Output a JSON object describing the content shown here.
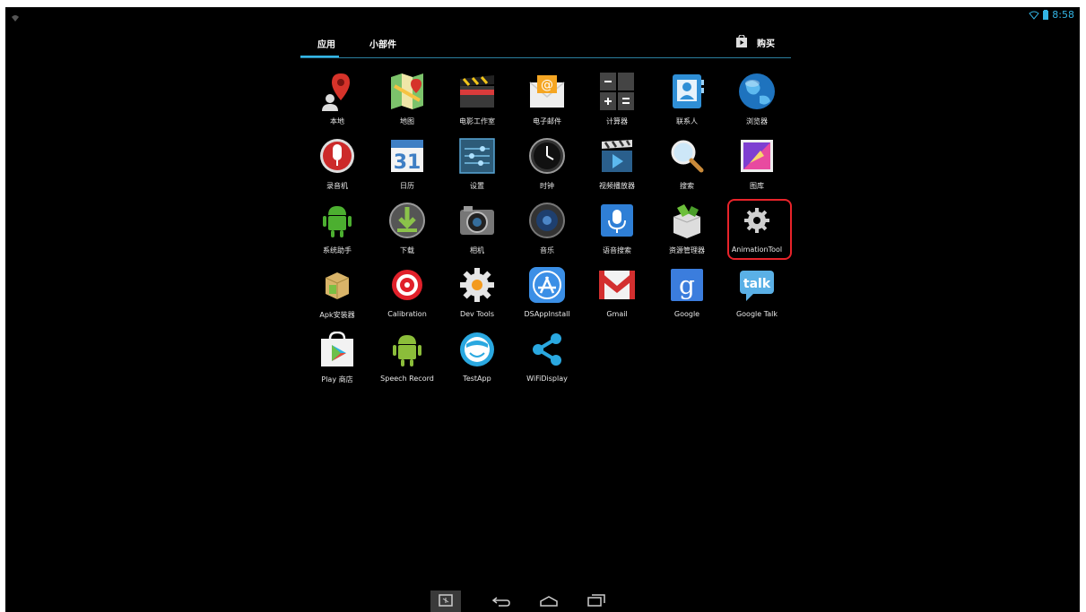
{
  "status": {
    "time": "8:58"
  },
  "tabs": {
    "apps": "应用",
    "widgets": "小部件",
    "store": "购买"
  },
  "apps": [
    {
      "label": "本地"
    },
    {
      "label": "地图"
    },
    {
      "label": "电影工作室"
    },
    {
      "label": "电子邮件"
    },
    {
      "label": "计算器"
    },
    {
      "label": "联系人"
    },
    {
      "label": "浏览器"
    },
    {
      "label": "录音机"
    },
    {
      "label": "日历"
    },
    {
      "label": "设置"
    },
    {
      "label": "时钟"
    },
    {
      "label": "视频播放器"
    },
    {
      "label": "搜索"
    },
    {
      "label": "图库"
    },
    {
      "label": "系统助手"
    },
    {
      "label": "下载"
    },
    {
      "label": "相机"
    },
    {
      "label": "音乐"
    },
    {
      "label": "语音搜索"
    },
    {
      "label": "资源管理器"
    },
    {
      "label": "AnimationTool"
    },
    {
      "label": "Apk安装器"
    },
    {
      "label": "Calibration"
    },
    {
      "label": "Dev Tools"
    },
    {
      "label": "DSAppInstall"
    },
    {
      "label": "Gmail"
    },
    {
      "label": "Google"
    },
    {
      "label": "Google Talk"
    },
    {
      "label": "Play 商店"
    },
    {
      "label": "Speech Record"
    },
    {
      "label": "TestApp"
    },
    {
      "label": "WiFiDisplay"
    }
  ],
  "icons": {
    "calendar_day": "31",
    "google_letter": "g",
    "talk_text": "talk"
  },
  "colors": {
    "accent": "#33b5e5",
    "highlight": "#e8232a"
  }
}
